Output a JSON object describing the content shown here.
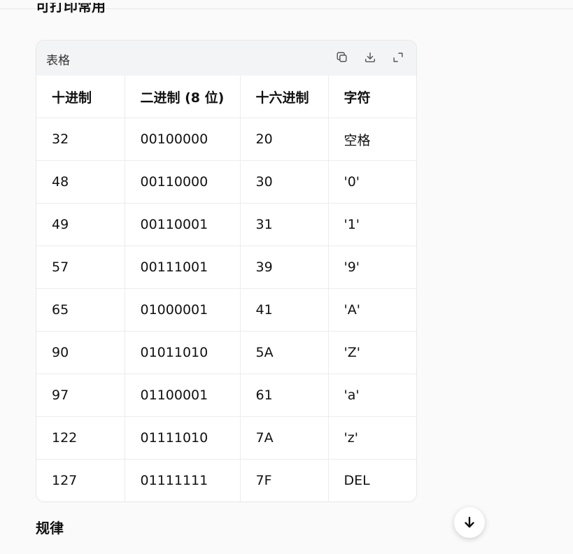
{
  "section_top": {
    "heading": "可打印常用"
  },
  "table_card": {
    "title": "表格",
    "actions": [
      {
        "name": "copy-icon"
      },
      {
        "name": "download-icon"
      },
      {
        "name": "expand-icon"
      }
    ],
    "columns": [
      "十进制",
      "二进制 (8 位)",
      "十六进制",
      "字符"
    ],
    "rows": [
      [
        "32",
        "00100000",
        "20",
        "空格"
      ],
      [
        "48",
        "00110000",
        "30",
        "'0'"
      ],
      [
        "49",
        "00110001",
        "31",
        "'1'"
      ],
      [
        "57",
        "00111001",
        "39",
        "'9'"
      ],
      [
        "65",
        "01000001",
        "41",
        "'A'"
      ],
      [
        "90",
        "01011010",
        "5A",
        "'Z'"
      ],
      [
        "97",
        "01100001",
        "61",
        "'a'"
      ],
      [
        "122",
        "01111010",
        "7A",
        "'z'"
      ],
      [
        "127",
        "01111111",
        "7F",
        "DEL"
      ]
    ]
  },
  "section_bottom": {
    "heading": "规律"
  },
  "scroll_button": {
    "icon": "arrow-down-icon"
  }
}
